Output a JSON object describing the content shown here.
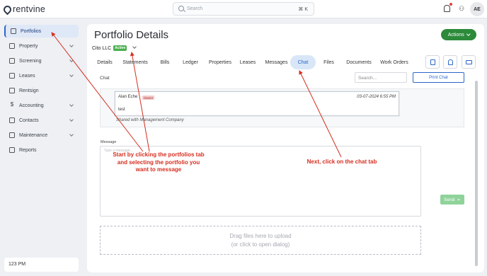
{
  "brand": {
    "name": "rentvine"
  },
  "topbar": {
    "search_placeholder": "Search",
    "search_shortcut": "⌘ K",
    "avatar_initials": "AE"
  },
  "sidebar": {
    "items": [
      {
        "label": "Portfolios",
        "icon": "portfolio-icon",
        "active": true
      },
      {
        "label": "Property",
        "icon": "property-icon",
        "has_chevron": true
      },
      {
        "label": "Screening",
        "icon": "screening-icon",
        "has_chevron": true
      },
      {
        "label": "Leases",
        "icon": "leases-icon",
        "has_chevron": true
      },
      {
        "label": "Rentsign",
        "icon": "rentsign-icon"
      },
      {
        "label": "Accounting",
        "icon": "dollar-icon",
        "has_chevron": true
      },
      {
        "label": "Contacts",
        "icon": "contacts-icon",
        "has_chevron": true
      },
      {
        "label": "Maintenance",
        "icon": "wrench-icon",
        "has_chevron": true
      },
      {
        "label": "Reports",
        "icon": "reports-icon"
      }
    ],
    "footer": "123 PM"
  },
  "page": {
    "title": "Portfolio Details",
    "actions_label": "Actions",
    "portfolio_name": "Cito LLC",
    "status_badge": "Active",
    "accent_color": "#2b66c9",
    "actions_color": "#2c8a3a"
  },
  "tabs": [
    {
      "label": "Details"
    },
    {
      "label": "Statements"
    },
    {
      "label": "Bills"
    },
    {
      "label": "Ledger"
    },
    {
      "label": "Properties"
    },
    {
      "label": "Leases"
    },
    {
      "label": "Messages"
    },
    {
      "label": "Chat",
      "active": true
    },
    {
      "label": "Files"
    },
    {
      "label": "Documents"
    },
    {
      "label": "Work Orders"
    }
  ],
  "toolbar_icons": [
    "note-icon",
    "bell-icon",
    "mail-icon"
  ],
  "chat": {
    "label": "Chat",
    "search_placeholder": "Search...",
    "print_label": "Print Chat",
    "messages": [
      {
        "author": "Alan Eche",
        "role": "Owner",
        "timestamp": "03-07-2024 6:55 PM",
        "text": "test"
      }
    ],
    "shared_note": "Shared with Management Company",
    "message_label": "Message",
    "message_placeholder": "Type a message...",
    "send_label": "Send",
    "dropzone_line1": "Drag files here to upload",
    "dropzone_line2": "(or click to open dialog)"
  },
  "annotations": {
    "left": [
      "Start by clicking the portfolios tab",
      "and selecting the portfolio you",
      "want to message"
    ],
    "right": "Next, click on the chat tab"
  }
}
